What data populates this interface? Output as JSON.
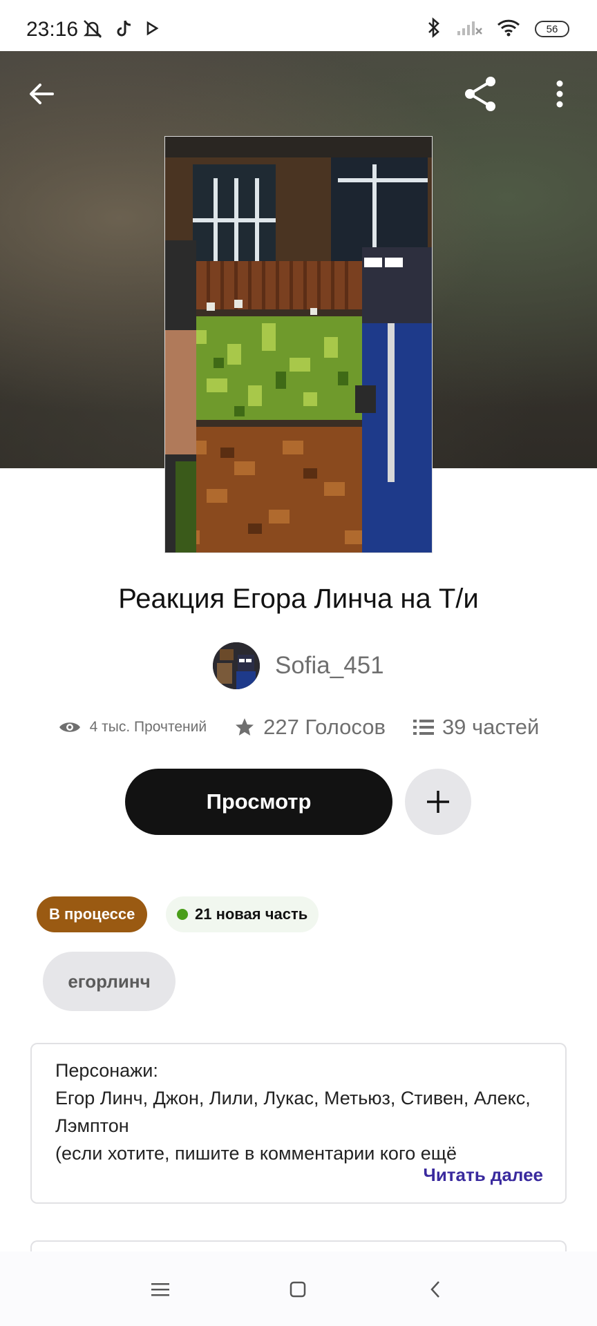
{
  "status_bar": {
    "time": "23:16",
    "battery": "56",
    "icons_left": [
      "mute-icon",
      "tiktok-icon",
      "play-icon"
    ],
    "icons_right": [
      "bluetooth-icon",
      "signal-icon",
      "wifi-icon",
      "battery-icon"
    ]
  },
  "header": {
    "back_icon": "arrow-left-icon",
    "share_icon": "share-icon",
    "more_icon": "more-vertical-icon"
  },
  "story": {
    "title": "Реакция Егора Линча на Т/и",
    "author": "Sofia_451",
    "stats": {
      "reads": "4 тыс. Прочтений",
      "votes": "227 Голосов",
      "parts": "39 частей"
    },
    "read_button": "Просмотр",
    "status_badge": "В процессе",
    "new_parts_badge": "21 новая часть",
    "tag": "егорлинч",
    "description": "Персонажи:\nЕгор Линч, Джон, Лили, Лукас, Метьюз, Стивен, Алекс, Лэмптон\n(если хотите, пишите в комментарии кого ещё",
    "read_more": "Читать далее"
  },
  "colors": {
    "primary_button": "#121212",
    "status_badge": "#9a5a12",
    "new_dot": "#4a9e1a",
    "read_more": "#3a2a9e"
  },
  "nav": {
    "menu_icon": "menu-icon",
    "home_icon": "square-home-icon",
    "back_icon": "chevron-left-icon"
  }
}
